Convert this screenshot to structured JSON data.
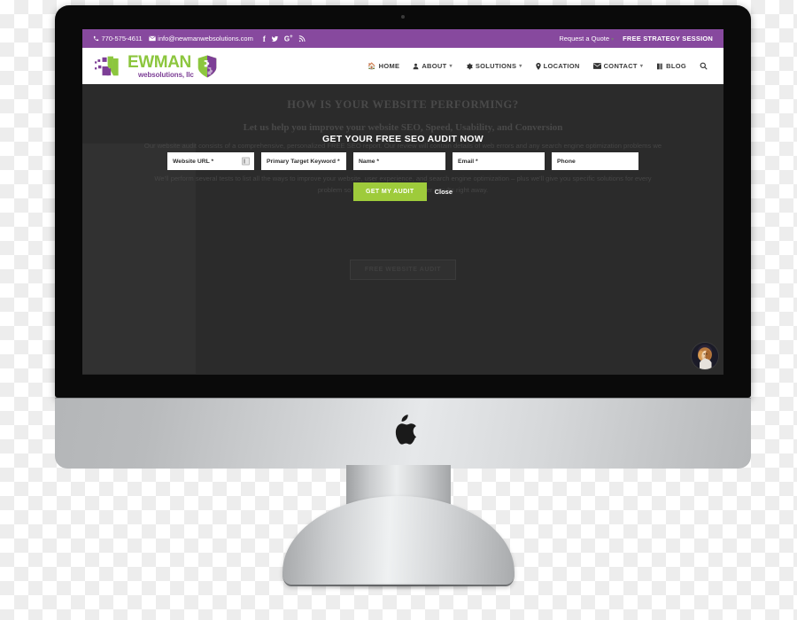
{
  "device": {
    "brand_logo": "apple-logo",
    "camera": "webcam-dot"
  },
  "site": {
    "topbar": {
      "phone": "770-575-4611",
      "email": "info@newmanwebsolutions.com",
      "social": [
        {
          "name": "facebook-icon",
          "glyph": "f"
        },
        {
          "name": "twitter-icon",
          "glyph": "✈"
        },
        {
          "name": "google-plus-icon",
          "glyph": "G+"
        },
        {
          "name": "rss-icon",
          "glyph": "◜"
        }
      ],
      "request_quote": "Request a Quote",
      "free_strategy": "FREE STRATEGY SESSION"
    },
    "logo": {
      "word": "EWMAN",
      "sub": "websolutions, llc",
      "green": "#8CC63E",
      "purple": "#7D3F96"
    },
    "nav": [
      {
        "label": "HOME",
        "icon": "home-icon",
        "caret": false
      },
      {
        "label": "ABOUT",
        "icon": "user-icon",
        "caret": true
      },
      {
        "label": "SOLUTIONS",
        "icon": "gear-icon",
        "caret": true
      },
      {
        "label": "LOCATION",
        "icon": "map-pin-icon",
        "caret": false
      },
      {
        "label": "CONTACT",
        "icon": "envelope-icon",
        "caret": true
      },
      {
        "label": "BLOG",
        "icon": "book-icon",
        "caret": false
      }
    ],
    "search_icon": "search-icon",
    "hero": {
      "h1": "HOW IS YOUR WEBSITE PERFORMING?",
      "h2": "Let us help you improve your website SEO, Speed, Usability, and Conversion",
      "p1": "Our website audit consists of a comprehensive, personalized FREE SEO report. Our review will contain details of web errors and any search engine optimization problems we find on your website.",
      "p2": "We'll perform several tests to list all the ways to improve your website, user experience, and search engine optimization – plus we'll give you specific solutions for every problem so you can start getting better results right away.",
      "ghost_button": "FREE WEBSITE AUDIT"
    },
    "modal": {
      "title": "GET YOUR FREE SEO AUDIT NOW",
      "fields": [
        {
          "placeholder": "Website URL *",
          "name": "website-url-field",
          "has_autofill_icon": true
        },
        {
          "placeholder": "Primary Target Keyword *",
          "name": "primary-keyword-field",
          "has_autofill_icon": false
        },
        {
          "placeholder": "Name *",
          "name": "name-field",
          "has_autofill_icon": false
        },
        {
          "placeholder": "Email *",
          "name": "email-field",
          "has_autofill_icon": false
        },
        {
          "placeholder": "Phone",
          "name": "phone-field",
          "has_autofill_icon": false
        }
      ],
      "submit_label": "GET MY AUDIT",
      "close_label": "Close",
      "submit_color": "#9ECB3B"
    },
    "chat_avatar": "support-agent-avatar"
  },
  "colors": {
    "topbar_purple": "#87499E",
    "accent_green": "#9ECB3B",
    "hero_dark": "#2B2B2B",
    "bezel_black": "#0A0A0A",
    "chin_silver": "#D3D5D7"
  }
}
